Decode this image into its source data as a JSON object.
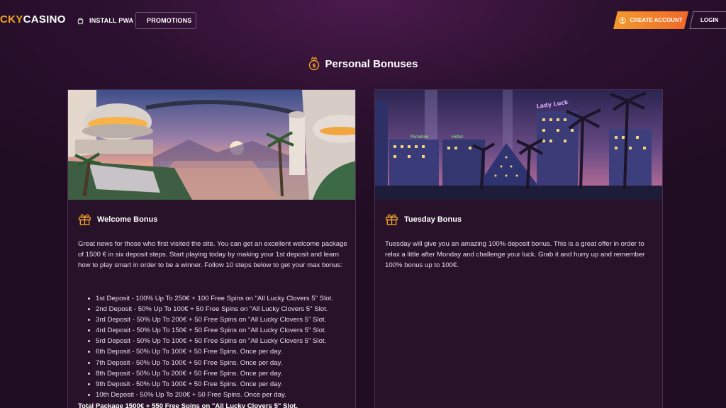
{
  "header": {
    "logo_part1": "CKY",
    "logo_part2": "CASINO",
    "install_pwa": "INSTALL PWA",
    "promotions": "PROMOTIONS",
    "create_account": "CREATE ACCOUNT",
    "login": "LOGIN"
  },
  "page": {
    "title": "Personal Bonuses"
  },
  "cards": [
    {
      "title": "Welcome Bonus",
      "text": "Great news for those who first visited the site. You can get an excellent welcome package of 1500 € in six deposit steps. Start playing today by making your 1st deposit and learn how to play smart in order to be a winner. Follow 10 steps below to get your max bonus:",
      "items": [
        "1st Deposit - 100% Up To 250€ + 100 Free Spins on \"All Lucky Clovers 5\" Slot.",
        "2nd Deposit - 50% Up To 100€ + 50 Free Spins on \"All Lucky Clovers 5\" Slot.",
        "3rd Deposit - 50% Up To 200€ + 50 Free Spins on \"All Lucky Clovers 5\" Slot.",
        "4rd Deposit - 50% Up To 150€ + 50 Free Spins on \"All Lucky Clovers 5\" Slot.",
        "5rd Deposit - 50% Up To 100€ + 50 Free Spins on \"All Lucky Clovers 5\" Slot.",
        "6th Deposit - 50% Up To 100€ + 50 Free Spins. Once per day.",
        "7th Deposit - 50% Up To 100€ + 50 Free Spins. Once per day.",
        "8th Deposit - 50% Up To 200€ + 50 Free Spins. Once per day.",
        "9th Deposit - 50% Up To 100€ + 50 Free Spins. Once per day.",
        "10th Deposit - 50% Up To 200€ + 50 Free Spins. Once per day."
      ],
      "total": "Total Package 1500€ + 550 Free Spins on \"All Lucky Clovers 5\" Slot."
    },
    {
      "title": "Tuesday Bonus",
      "text": "Tuesday will give you an amazing 100% deposit bonus. This is a great offer in order to relax a little after Monday and challenge your luck. Grab it and hurry up and remember 100% bonus up to 100€."
    }
  ],
  "images": {
    "tuesday_signs": [
      "Lady Luck",
      "Paradise",
      "Hotel"
    ]
  },
  "icons": {
    "install_pwa": "android-icon",
    "promotions": "chip-icon",
    "create_account": "user-icon",
    "title": "coin-badge-icon",
    "card_head": "gift-icon"
  },
  "colors": {
    "accent_orange": "#f39a2c",
    "accent_red": "#f0692a",
    "background": "#2c1130",
    "card": "#281229"
  }
}
